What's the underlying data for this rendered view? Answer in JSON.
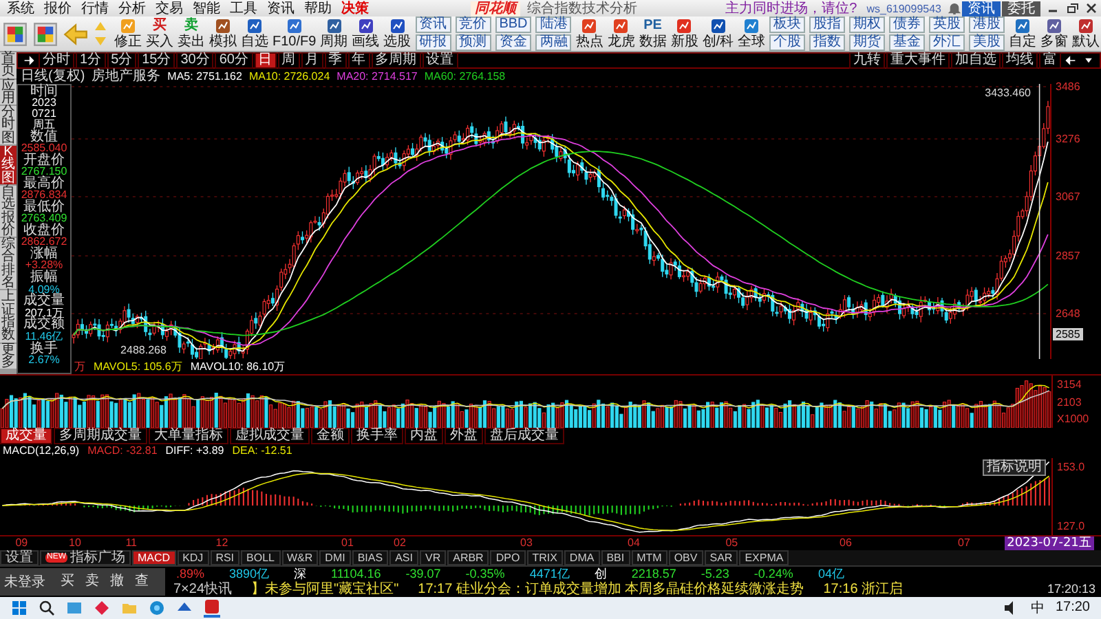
{
  "menu": {
    "items": [
      {
        "label": "系统",
        "kind": "normal"
      },
      {
        "label": "报价",
        "kind": "normal"
      },
      {
        "label": "行情",
        "kind": "normal"
      },
      {
        "label": "分析",
        "kind": "normal"
      },
      {
        "label": "交易",
        "kind": "normal"
      },
      {
        "label": "智能",
        "kind": "normal"
      },
      {
        "label": "工具",
        "kind": "normal"
      },
      {
        "label": "资讯",
        "kind": "normal"
      },
      {
        "label": "帮助",
        "kind": "normal"
      },
      {
        "label": "决策",
        "kind": "highlight"
      }
    ],
    "logo": "同花顺",
    "title": "综合指数技术分析",
    "alert": "主力同时进场，请位?",
    "user": "ws_619099543",
    "buttons": [
      "资讯",
      "委托"
    ]
  },
  "toolbar": [
    {
      "kind": "icon",
      "label": "修正"
    },
    {
      "kind": "icon",
      "label": "买入",
      "glyph": "买"
    },
    {
      "kind": "icon",
      "label": "卖出",
      "glyph": "卖"
    },
    {
      "kind": "icon",
      "label": "模拟"
    },
    {
      "kind": "icon",
      "label": "自选"
    },
    {
      "kind": "icon",
      "label": "F10/F9"
    },
    {
      "kind": "icon",
      "label": "周期"
    },
    {
      "kind": "icon",
      "label": "画线"
    },
    {
      "kind": "icon",
      "label": "选股"
    },
    {
      "kind": "pair",
      "labels": [
        "资讯",
        "研报"
      ]
    },
    {
      "kind": "pair",
      "labels": [
        "竞价",
        "预测"
      ]
    },
    {
      "kind": "pair",
      "labels": [
        "BBD",
        "资金"
      ]
    },
    {
      "kind": "pair",
      "labels": [
        "陆港",
        "两融"
      ]
    },
    {
      "kind": "icon",
      "label": "热点"
    },
    {
      "kind": "icon",
      "label": "龙虎"
    },
    {
      "kind": "icon",
      "label": "数据",
      "glyph": "PE"
    },
    {
      "kind": "icon",
      "label": "新股"
    },
    {
      "kind": "icon",
      "label": "创/科"
    },
    {
      "kind": "icon",
      "label": "全球"
    },
    {
      "kind": "pair",
      "labels": [
        "板块",
        "个股"
      ]
    },
    {
      "kind": "pair",
      "labels": [
        "股指",
        "指数"
      ]
    },
    {
      "kind": "pair",
      "labels": [
        "期权",
        "期货"
      ]
    },
    {
      "kind": "pair",
      "labels": [
        "债券",
        "基金"
      ]
    },
    {
      "kind": "pair",
      "labels": [
        "英股",
        "外汇"
      ]
    },
    {
      "kind": "pair",
      "labels": [
        "港股",
        "美股"
      ]
    },
    {
      "kind": "icon",
      "label": "自定"
    },
    {
      "kind": "icon",
      "label": "多窗"
    },
    {
      "kind": "icon",
      "label": "默认"
    }
  ],
  "side_tabs": [
    {
      "label": "首页",
      "selected": false
    },
    {
      "label": "应用",
      "selected": false
    },
    {
      "label": "分时图",
      "selected": false
    },
    {
      "label": "K线图",
      "selected": true
    },
    {
      "label": "自选报价",
      "selected": false
    },
    {
      "label": "综合排名",
      "selected": false
    },
    {
      "label": "上证指数",
      "selected": false
    },
    {
      "label": "更多",
      "selected": false
    }
  ],
  "periods": [
    {
      "label": "分时",
      "selected": false
    },
    {
      "label": "1分",
      "selected": false
    },
    {
      "label": "5分",
      "selected": false
    },
    {
      "label": "15分",
      "selected": false
    },
    {
      "label": "30分",
      "selected": false
    },
    {
      "label": "60分",
      "selected": false
    },
    {
      "label": "日",
      "selected": true
    },
    {
      "label": "周",
      "selected": false
    },
    {
      "label": "月",
      "selected": false
    },
    {
      "label": "季",
      "selected": false
    },
    {
      "label": "年",
      "selected": false
    },
    {
      "label": "多周期",
      "selected": false
    },
    {
      "label": "设置",
      "selected": false
    }
  ],
  "chart_tools": [
    "九转",
    "重大事件",
    "加自选",
    "均线",
    "富"
  ],
  "info_line": {
    "mode": "日线(复权)",
    "sector": "房地产服务",
    "ma": [
      {
        "label": "MA5: 2751.162",
        "color": "#ffffff"
      },
      {
        "label": "MA10: 2726.024",
        "color": "#e8e800"
      },
      {
        "label": "MA20: 2714.517",
        "color": "#e040e0"
      },
      {
        "label": "MA60: 2764.158",
        "color": "#20d020"
      }
    ]
  },
  "info_panel": [
    {
      "label": "时间",
      "values": [
        "2023",
        "0721",
        "周五"
      ],
      "color": "#ffffff"
    },
    {
      "label": "数值",
      "values": [
        "2585.040"
      ],
      "color": "#e83030"
    },
    {
      "label": "开盘价",
      "values": [
        "2767.150"
      ],
      "color": "#30e030"
    },
    {
      "label": "最高价",
      "values": [
        "2876.834"
      ],
      "color": "#e83030"
    },
    {
      "label": "最低价",
      "values": [
        "2763.409"
      ],
      "color": "#30e030"
    },
    {
      "label": "收盘价",
      "values": [
        "2862.672"
      ],
      "color": "#e83030"
    },
    {
      "label": "涨幅",
      "values": [
        "+3.28%"
      ],
      "color": "#e83030"
    },
    {
      "label": "振幅",
      "values": [
        "4.09%"
      ],
      "color": "#20c8e8"
    },
    {
      "label": "成交量",
      "values": [
        "207.1万"
      ],
      "color": "#ffffff"
    },
    {
      "label": "成交额",
      "values": [
        "11.46亿"
      ],
      "color": "#20c8e8"
    },
    {
      "label": "换手",
      "values": [
        "2.67%"
      ],
      "color": "#20c8e8"
    }
  ],
  "price_axis": [
    "3486",
    "3276",
    "3067",
    "2857",
    "2648"
  ],
  "price_cursor": "2585",
  "high_marker": "3433.460",
  "low_marker": "2488.268",
  "vol_legend": [
    {
      "label": "万",
      "color": "#e83030"
    },
    {
      "label": "MAVOL5: 105.6万",
      "color": "#e8e800"
    },
    {
      "label": "MAVOL10: 86.10万",
      "color": "#ffffff"
    }
  ],
  "vol_axis": [
    "3154",
    "2103",
    "X1000"
  ],
  "vol_tabs": [
    {
      "label": "成交量",
      "selected": true
    },
    {
      "label": "多周期成交量",
      "selected": false
    },
    {
      "label": "大单量指标",
      "selected": false
    },
    {
      "label": "虚拟成交量",
      "selected": false
    },
    {
      "label": "金额",
      "selected": false
    },
    {
      "label": "换手率",
      "selected": false
    },
    {
      "label": "内盘",
      "selected": false
    },
    {
      "label": "外盘",
      "selected": false
    },
    {
      "label": "盘后成交量",
      "selected": false
    }
  ],
  "macd_legend": [
    {
      "label": "MACD(12,26,9)",
      "color": "#ffffff"
    },
    {
      "label": "MACD: -32.81",
      "color": "#e83030"
    },
    {
      "label": "DIFF: +3.89",
      "color": "#ffffff"
    },
    {
      "label": "DEA: -12.51",
      "color": "#e8e800"
    }
  ],
  "macd_axis": [
    "153.0",
    "127.0"
  ],
  "macd_help": "指标说明",
  "months": [
    "09",
    "10",
    "11",
    "12",
    "01",
    "02",
    "03",
    "04",
    "05",
    "06",
    "07"
  ],
  "cursor_date": "2023-07-21五",
  "indicator_tabs": [
    {
      "label": "设置",
      "selected": false
    },
    {
      "label": "指标广场",
      "selected": false,
      "badge": "NEW"
    },
    {
      "label": "MACD",
      "selected": true
    },
    {
      "label": "KDJ",
      "selected": false
    },
    {
      "label": "RSI",
      "selected": false
    },
    {
      "label": "BOLL",
      "selected": false
    },
    {
      "label": "W&R",
      "selected": false
    },
    {
      "label": "DMI",
      "selected": false
    },
    {
      "label": "BIAS",
      "selected": false
    },
    {
      "label": "ASI",
      "selected": false
    },
    {
      "label": "VR",
      "selected": false
    },
    {
      "label": "ARBR",
      "selected": false
    },
    {
      "label": "DPO",
      "selected": false
    },
    {
      "label": "TRIX",
      "selected": false
    },
    {
      "label": "DMA",
      "selected": false
    },
    {
      "label": "BBI",
      "selected": false
    },
    {
      "label": "MTM",
      "selected": false
    },
    {
      "label": "OBV",
      "selected": false
    },
    {
      "label": "SAR",
      "selected": false
    },
    {
      "label": "EXPMA",
      "selected": false
    }
  ],
  "ticker": [
    {
      "text": ".89%",
      "color": "#e83030"
    },
    {
      "text": "3890亿",
      "color": "#20c8e8"
    },
    {
      "text": "深",
      "color": "#ffffff"
    },
    {
      "text": "11104.16",
      "color": "#30e030"
    },
    {
      "text": "-39.07",
      "color": "#30e030"
    },
    {
      "text": "-0.35%",
      "color": "#30e030"
    },
    {
      "text": "4471亿",
      "color": "#20c8e8"
    },
    {
      "text": "创",
      "color": "#ffffff"
    },
    {
      "text": "2218.57",
      "color": "#30e030"
    },
    {
      "text": "-5.23",
      "color": "#30e030"
    },
    {
      "text": "-0.24%",
      "color": "#30e030"
    },
    {
      "text": "04亿",
      "color": "#20c8e8"
    }
  ],
  "trade_popup": {
    "status": "未登录",
    "actions": [
      "买",
      "卖",
      "撤",
      "查"
    ]
  },
  "news": {
    "source": "7×24快讯",
    "items": [
      "】未参与阿里\"藏宝社区\"",
      "17:17 硅业分会：订单成交量增加 本周多晶硅价格延续微涨走势",
      "17:16 浙江启"
    ],
    "clock": "17:20:13"
  },
  "taskbar": {
    "ime": "中",
    "time": "17:20"
  }
}
